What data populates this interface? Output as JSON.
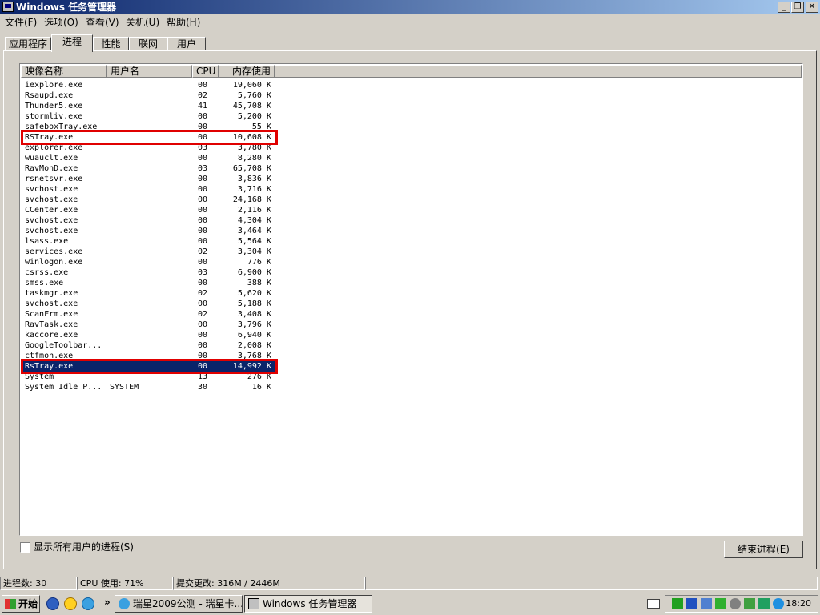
{
  "window": {
    "title": "Windows 任务管理器",
    "min_glyph": "_",
    "max_glyph": "❐",
    "close_glyph": "✕"
  },
  "menu": [
    "文件(F)",
    "选项(O)",
    "查看(V)",
    "关机(U)",
    "帮助(H)"
  ],
  "tabs": [
    "应用程序",
    "进程",
    "性能",
    "联网",
    "用户"
  ],
  "active_tab": "进程",
  "columns": [
    "映像名称",
    "用户名",
    "CPU",
    "内存使用"
  ],
  "processes": [
    {
      "name": "iexplore.exe",
      "user": "",
      "cpu": "00",
      "mem": "19,060 K"
    },
    {
      "name": "Rsaupd.exe",
      "user": "",
      "cpu": "02",
      "mem": "5,760 K"
    },
    {
      "name": "Thunder5.exe",
      "user": "",
      "cpu": "41",
      "mem": "45,708 K"
    },
    {
      "name": "stormliv.exe",
      "user": "",
      "cpu": "00",
      "mem": "5,200 K"
    },
    {
      "name": "safeboxTray.exe",
      "user": "",
      "cpu": "00",
      "mem": "55 K"
    },
    {
      "name": "RSTray.exe",
      "user": "",
      "cpu": "00",
      "mem": "10,608 K"
    },
    {
      "name": "explorer.exe",
      "user": "",
      "cpu": "03",
      "mem": "3,780 K"
    },
    {
      "name": "wuauclt.exe",
      "user": "",
      "cpu": "00",
      "mem": "8,280 K"
    },
    {
      "name": "RavMonD.exe",
      "user": "",
      "cpu": "03",
      "mem": "65,708 K"
    },
    {
      "name": "rsnetsvr.exe",
      "user": "",
      "cpu": "00",
      "mem": "3,836 K"
    },
    {
      "name": "svchost.exe",
      "user": "",
      "cpu": "00",
      "mem": "3,716 K"
    },
    {
      "name": "svchost.exe",
      "user": "",
      "cpu": "00",
      "mem": "24,168 K"
    },
    {
      "name": "CCenter.exe",
      "user": "",
      "cpu": "00",
      "mem": "2,116 K"
    },
    {
      "name": "svchost.exe",
      "user": "",
      "cpu": "00",
      "mem": "4,304 K"
    },
    {
      "name": "svchost.exe",
      "user": "",
      "cpu": "00",
      "mem": "3,464 K"
    },
    {
      "name": "lsass.exe",
      "user": "",
      "cpu": "00",
      "mem": "5,564 K"
    },
    {
      "name": "services.exe",
      "user": "",
      "cpu": "02",
      "mem": "3,304 K"
    },
    {
      "name": "winlogon.exe",
      "user": "",
      "cpu": "00",
      "mem": "776 K"
    },
    {
      "name": "csrss.exe",
      "user": "",
      "cpu": "03",
      "mem": "6,900 K"
    },
    {
      "name": "smss.exe",
      "user": "",
      "cpu": "00",
      "mem": "388 K"
    },
    {
      "name": "taskmgr.exe",
      "user": "",
      "cpu": "02",
      "mem": "5,620 K"
    },
    {
      "name": "svchost.exe",
      "user": "",
      "cpu": "00",
      "mem": "5,188 K"
    },
    {
      "name": "ScanFrm.exe",
      "user": "",
      "cpu": "02",
      "mem": "3,408 K"
    },
    {
      "name": "RavTask.exe",
      "user": "",
      "cpu": "00",
      "mem": "3,796 K"
    },
    {
      "name": "kaccore.exe",
      "user": "",
      "cpu": "00",
      "mem": "6,940 K"
    },
    {
      "name": "GoogleToolbar...",
      "user": "",
      "cpu": "00",
      "mem": "2,008 K"
    },
    {
      "name": "ctfmon.exe",
      "user": "",
      "cpu": "00",
      "mem": "3,768 K"
    },
    {
      "name": "RsTray.exe",
      "user": "",
      "cpu": "00",
      "mem": "14,992 K",
      "selected": true
    },
    {
      "name": "System",
      "user": "",
      "cpu": "13",
      "mem": "276 K"
    },
    {
      "name": "System Idle P...",
      "user": "SYSTEM",
      "cpu": "30",
      "mem": "16 K"
    }
  ],
  "highlighted_rows": [
    5,
    27
  ],
  "show_all_users_label": "显示所有用户的进程(S)",
  "end_process_label": "结束进程(E)",
  "status": {
    "process_count": "进程数: 30",
    "cpu_usage": "CPU 使用: 71%",
    "commit": "提交更改: 316M / 2446M"
  },
  "taskbar": {
    "start_label": "开始",
    "chevron": "»",
    "buttons": [
      {
        "label": "瑞星2009公测 - 瑞星卡...",
        "active": false
      },
      {
        "label": "Windows 任务管理器",
        "active": true
      }
    ],
    "clock": "18:20"
  },
  "colors": {
    "selection": "#0a246a",
    "highlight_box": "#e00000",
    "title_gradient_start": "#0a246a",
    "title_gradient_end": "#a6caf0"
  }
}
